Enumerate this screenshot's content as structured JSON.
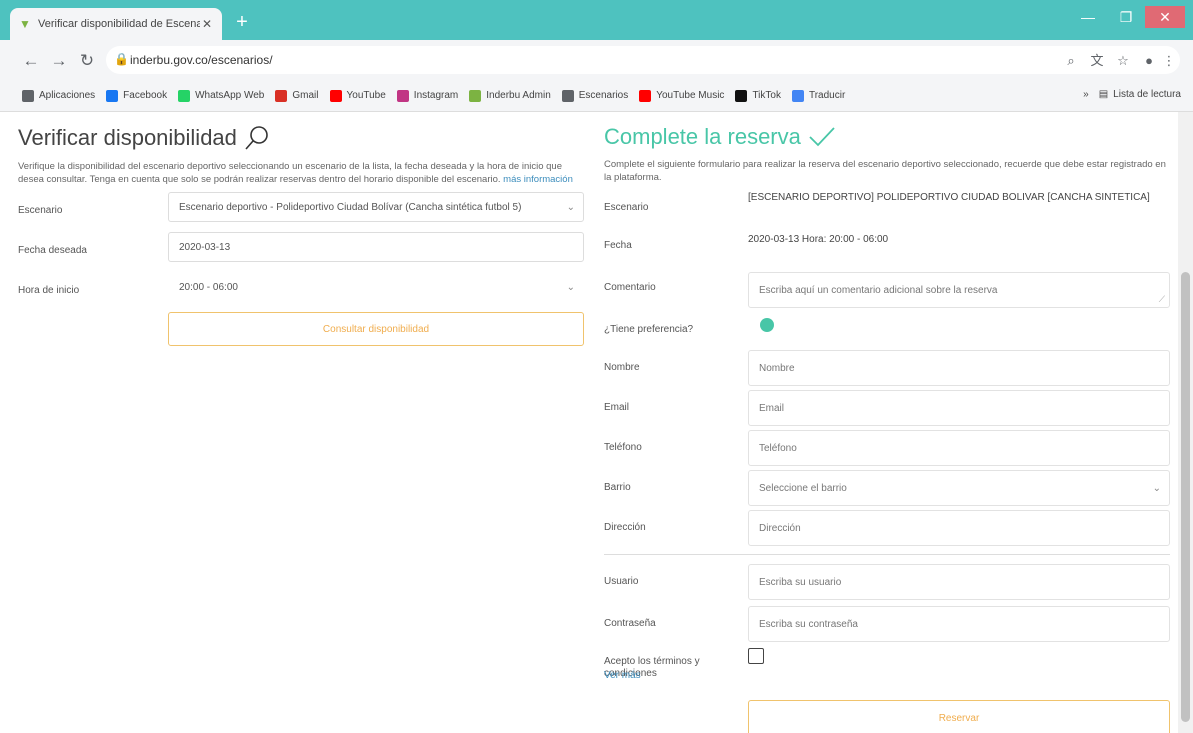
{
  "browser": {
    "tab_title": "Verificar disponibilidad de Escenar",
    "tab_close": "✕",
    "new_tab": "+",
    "url": "inderbu.gov.co/escenarios/",
    "bookmarks": [
      {
        "label": "Aplicaciones",
        "color": "#5f6368"
      },
      {
        "label": "Facebook",
        "color": "#1877f2"
      },
      {
        "label": "WhatsApp Web",
        "color": "#25d366"
      },
      {
        "label": "Gmail",
        "color": "#d93025"
      },
      {
        "label": "YouTube",
        "color": "#ff0000"
      },
      {
        "label": "Instagram",
        "color": "#c13584"
      },
      {
        "label": "Inderbu Admin",
        "color": "#7cb342"
      },
      {
        "label": "Escenarios",
        "color": "#5f6368"
      },
      {
        "label": "YouTube Music",
        "color": "#ff0000"
      },
      {
        "label": "TikTok",
        "color": "#111111"
      },
      {
        "label": "Traducir",
        "color": "#4285f4"
      }
    ],
    "reading_list": "Lista de lectura"
  },
  "left": {
    "title": "Verificar disponibilidad",
    "description": "Verifique la disponibilidad del escenario deportivo seleccionando un escenario de la lista, la fecha deseada y la hora de inicio que desea consultar. Tenga en cuenta que solo se podrán realizar reservas dentro del horario disponible del escenario.",
    "description_link": "más información",
    "fields": [
      {
        "label": "Escenario",
        "value": "Escenario deportivo - Polideportivo Ciudad Bolívar (Cancha sintética futbol 5)",
        "type": "select"
      },
      {
        "label": "Fecha deseada",
        "value": "2020-03-13",
        "type": "input"
      },
      {
        "label": "Hora de inicio",
        "value": "20:00 - 06:00",
        "type": "select"
      }
    ],
    "button": "Consultar disponibilidad"
  },
  "right": {
    "title": "Complete la reserva",
    "description": "Complete el siguiente formulario para realizar la reserva del escenario deportivo seleccionado, recuerde que debe estar registrado en la plataforma.",
    "escenario_label": "Escenario",
    "escenario_value": "[ESCENARIO DEPORTIVO] POLIDEPORTIVO CIUDAD BOLIVAR [CANCHA SINTETICA]",
    "fecha_label": "Fecha",
    "fecha_value": "2020-03-13 Hora: 20:00 - 06:00",
    "comentario_label": "Comentario",
    "comentario_placeholder": "Escriba aquí un comentario adicional sobre la reserva",
    "preferente_label": "¿Tiene preferencia?",
    "fields": [
      {
        "label": "Nombre",
        "value": "Nombre"
      },
      {
        "label": "Email",
        "value": "Email"
      },
      {
        "label": "Teléfono",
        "value": "Teléfono"
      },
      {
        "label": "Barrio",
        "value": "Seleccione el barrio",
        "type": "select"
      },
      {
        "label": "Dirección",
        "value": "Dirección"
      }
    ],
    "usuario_label": "Usuario",
    "usuario_placeholder": "Escriba su usuario",
    "password_label": "Contraseña",
    "password_placeholder": "Escriba su contraseña",
    "terms_label": "Acepto los términos y condiciones",
    "terms_link": "Ver más",
    "submit": "Reservar"
  },
  "colors": {
    "accent": "#48c6a7",
    "warning": "#f0ad4e",
    "chrome": "#4ec2bf"
  }
}
